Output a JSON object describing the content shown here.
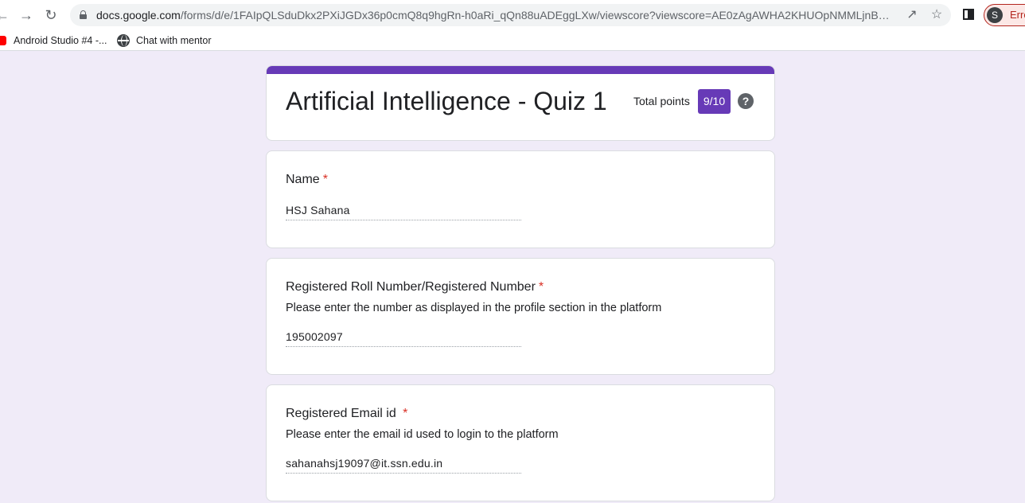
{
  "browser": {
    "url_host": "docs.google.com",
    "url_path": "/forms/d/e/1FAIpQLSduDkx2PXiJGDx36p0cmQ8q9hgRn-h0aRi_qQn88uADEggLXw/viewscore?viewscore=AE0zAgAWHA2KHUOpNMMLjnBoqyy...",
    "profile_initial": "S",
    "profile_status": "Erro",
    "bookmarks": [
      {
        "label": "Android Studio #4 -...",
        "icon": "youtube-icon"
      },
      {
        "label": "Chat with mentor",
        "icon": "globe-icon"
      }
    ]
  },
  "form": {
    "title": "Artificial Intelligence - Quiz 1",
    "total_points_label": "Total points",
    "score": "9/10",
    "accent_color": "#673ab7",
    "questions": [
      {
        "title": "Name",
        "required": "*",
        "description": "",
        "answer": "HSJ Sahana"
      },
      {
        "title": "Registered Roll Number/Registered Number",
        "required": "*",
        "description": "Please enter the number as displayed in the profile section in the platform",
        "answer": "195002097"
      },
      {
        "title": "Registered Email id ",
        "required": "*",
        "description": "Please enter the email id used to login to the platform",
        "answer": "sahanahsj19097@it.ssn.edu.in"
      }
    ]
  }
}
